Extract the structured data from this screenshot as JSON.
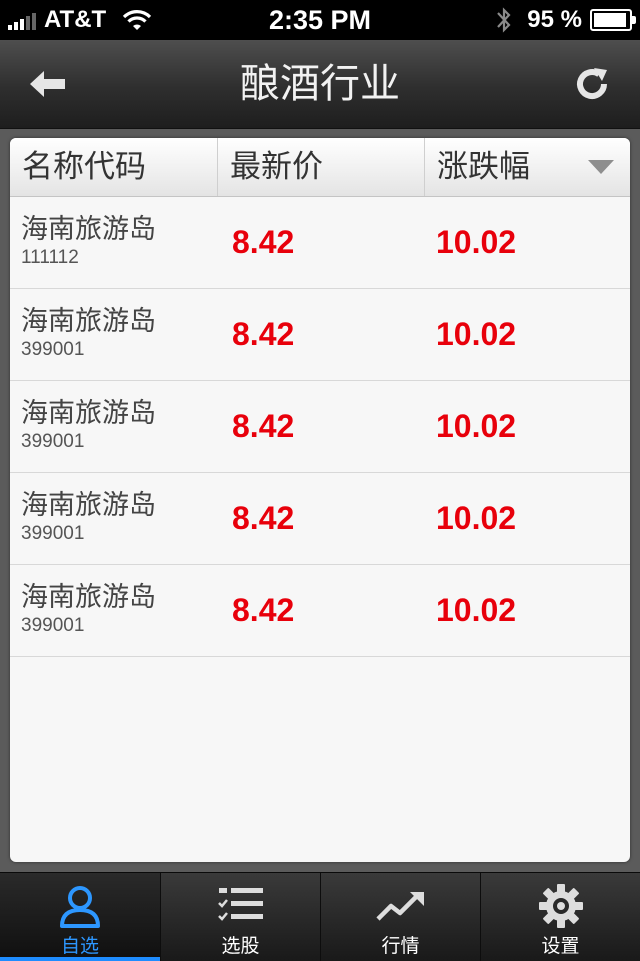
{
  "status_bar": {
    "carrier": "AT&T",
    "time": "2:35 PM",
    "battery_percent": "95 %",
    "battery_level": 0.95
  },
  "nav": {
    "title": "酿酒行业",
    "back_icon": "back-arrow-icon",
    "refresh_icon": "refresh-icon"
  },
  "table": {
    "headers": {
      "name": "名称代码",
      "price": "最新价",
      "change": "涨跌幅"
    },
    "sort_icon": "sort-down-icon",
    "rows": [
      {
        "name": "海南旅游岛",
        "code": "111112",
        "price": "8.42",
        "change": "10.02"
      },
      {
        "name": "海南旅游岛",
        "code": "399001",
        "price": "8.42",
        "change": "10.02"
      },
      {
        "name": "海南旅游岛",
        "code": "399001",
        "price": "8.42",
        "change": "10.02"
      },
      {
        "name": "海南旅游岛",
        "code": "399001",
        "price": "8.42",
        "change": "10.02"
      },
      {
        "name": "海南旅游岛",
        "code": "399001",
        "price": "8.42",
        "change": "10.02"
      }
    ]
  },
  "tabs": [
    {
      "label": "自选",
      "icon": "person-icon",
      "active": true
    },
    {
      "label": "选股",
      "icon": "checklist-icon",
      "active": false
    },
    {
      "label": "行情",
      "icon": "trend-chart-icon",
      "active": false
    },
    {
      "label": "设置",
      "icon": "gear-icon",
      "active": false
    }
  ],
  "colors": {
    "price_up": "#e8000b",
    "tab_active": "#2d97ff"
  }
}
